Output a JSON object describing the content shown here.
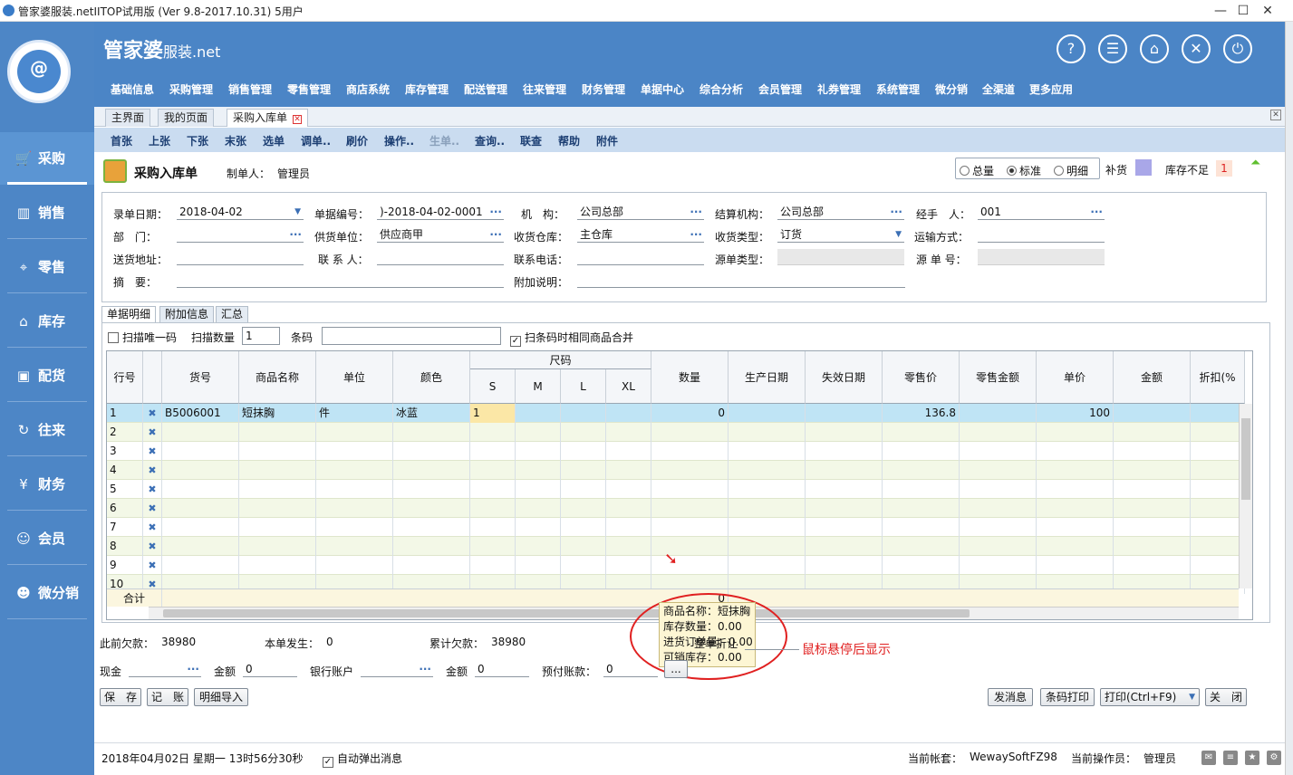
{
  "window": {
    "title": "管家婆服装.netIITOP试用版 (Ver 9.8-2017.10.31) 5用户"
  },
  "brand": {
    "name": "管家婆",
    "suffix": "服装.net"
  },
  "header_icons": [
    "help-icon",
    "message-icon",
    "lock-icon",
    "close-circle-icon",
    "power-icon"
  ],
  "menu": [
    "基础信息",
    "采购管理",
    "销售管理",
    "零售管理",
    "商店系统",
    "库存管理",
    "配送管理",
    "往来管理",
    "财务管理",
    "单据中心",
    "综合分析",
    "会员管理",
    "礼券管理",
    "系统管理",
    "微分销",
    "全渠道",
    "更多应用"
  ],
  "sidebar": {
    "items": [
      {
        "label": "采购",
        "icon": "cart-icon"
      },
      {
        "label": "销售",
        "icon": "chart-icon"
      },
      {
        "label": "零售",
        "icon": "tag-icon"
      },
      {
        "label": "库存",
        "icon": "home-icon"
      },
      {
        "label": "配货",
        "icon": "box-icon"
      },
      {
        "label": "往来",
        "icon": "refresh-icon"
      },
      {
        "label": "财务",
        "icon": "yen-icon"
      },
      {
        "label": "会员",
        "icon": "user-icon"
      },
      {
        "label": "微分销",
        "icon": "group-icon"
      }
    ]
  },
  "tabs": [
    "主界面",
    "我的页面",
    "采购入库单"
  ],
  "toolbar": [
    "首张",
    "上张",
    "下张",
    "末张",
    "选单",
    "调单..",
    "刷价",
    "操作..",
    "生单..",
    "查询..",
    "联查",
    "帮助",
    "附件"
  ],
  "form": {
    "title": "采购入库单",
    "creator_label": "制单人：",
    "creator": "管理员",
    "view_options": [
      "总量",
      "标准",
      "明细"
    ],
    "view_selected": "标准",
    "bu_label": "补货",
    "low_stock_label": "库存不足",
    "low_stock_value": "1",
    "fields": {
      "date_label": "录单日期：",
      "date": "2018-04-02",
      "docno_label": "单据编号：",
      "docno": ")-2018-04-02-0001",
      "org_label": "机　构：",
      "org": "公司总部",
      "settle_label": "结算机构：",
      "settle": "公司总部",
      "handler_label": "经手　人：",
      "handler": "001",
      "dept_label": "部　门：",
      "dept": "",
      "supplier_label": "供货单位：",
      "supplier": "供应商甲",
      "warehouse_label": "收货仓库：",
      "warehouse": "主仓库",
      "recvtype_label": "收货类型：",
      "recvtype": "订货",
      "ship_label": "运输方式：",
      "ship": "",
      "addr_label": "送货地址：",
      "addr": "",
      "contact_label": "联 系 人：",
      "contact": "",
      "phone_label": "联系电话：",
      "phone": "",
      "srctype_label": "源单类型：",
      "srctype": "",
      "srcno_label": "源 单 号：",
      "srcno": "",
      "summary_label": "摘　要：",
      "summary": "",
      "note_label": "附加说明：",
      "note": ""
    }
  },
  "subtabs": [
    "单据明细",
    "附加信息",
    "汇总"
  ],
  "scan": {
    "unique_label": "扫描唯一码",
    "qty_label": "扫描数量",
    "qty": "1",
    "barcode_label": "条码",
    "barcode": "",
    "merge_label": "扫条码时相同商品合并"
  },
  "grid": {
    "headers": {
      "row": "行号",
      "code": "货号",
      "name": "商品名称",
      "unit": "单位",
      "color": "颜色",
      "size": "尺码",
      "sizes": [
        "S",
        "M",
        "L",
        "XL"
      ],
      "qty": "数量",
      "mfg": "生产日期",
      "exp": "失效日期",
      "retail": "零售价",
      "retail_amt": "零售金额",
      "price": "单价",
      "amount": "金额",
      "discount": "折扣(%"
    },
    "row1": {
      "no": "1",
      "code": "B5006001",
      "name": "短抹胸",
      "unit": "件",
      "color": "冰蓝",
      "s": "1",
      "qty": "0",
      "retail": "136.8",
      "price": "100"
    },
    "row_numbers": [
      "2",
      "3",
      "4",
      "5",
      "6",
      "7",
      "8",
      "9",
      "10"
    ],
    "total_label": "合计",
    "total_qty": "0"
  },
  "tooltip": [
    "商品名称：短抹胸",
    "库存数量：0.00",
    "进货订单量：0.00",
    "可销库存：0.00"
  ],
  "annotation": "鼠标悬停后显示",
  "summary": {
    "prev_debt_label": "此前欠款：",
    "prev_debt": "38980",
    "this_label": "本单发生：",
    "this": "0",
    "cum_label": "累计欠款：",
    "cum": "38980",
    "discount_label": "整单折让",
    "cash_label": "现金",
    "amount_label": "金额",
    "amount1": "0",
    "bank_label": "银行账户",
    "amount2": "0",
    "prepay_label": "预付账款：",
    "prepay": "0"
  },
  "buttons": {
    "save": "保　存",
    "post": "记　账",
    "import": "明细导入",
    "send": "发消息",
    "barcode": "条码打印",
    "print": "打印(Ctrl+F9)",
    "close": "关　闭",
    "more": "..."
  },
  "status": {
    "datetime": "2018年04月02日 星期一 13时56分30秒",
    "auto_popup": "自动弹出消息",
    "account_label": "当前帐套：",
    "account": "WewaySoftFZ98",
    "operator_label": "当前操作员：",
    "operator": "管理员"
  }
}
